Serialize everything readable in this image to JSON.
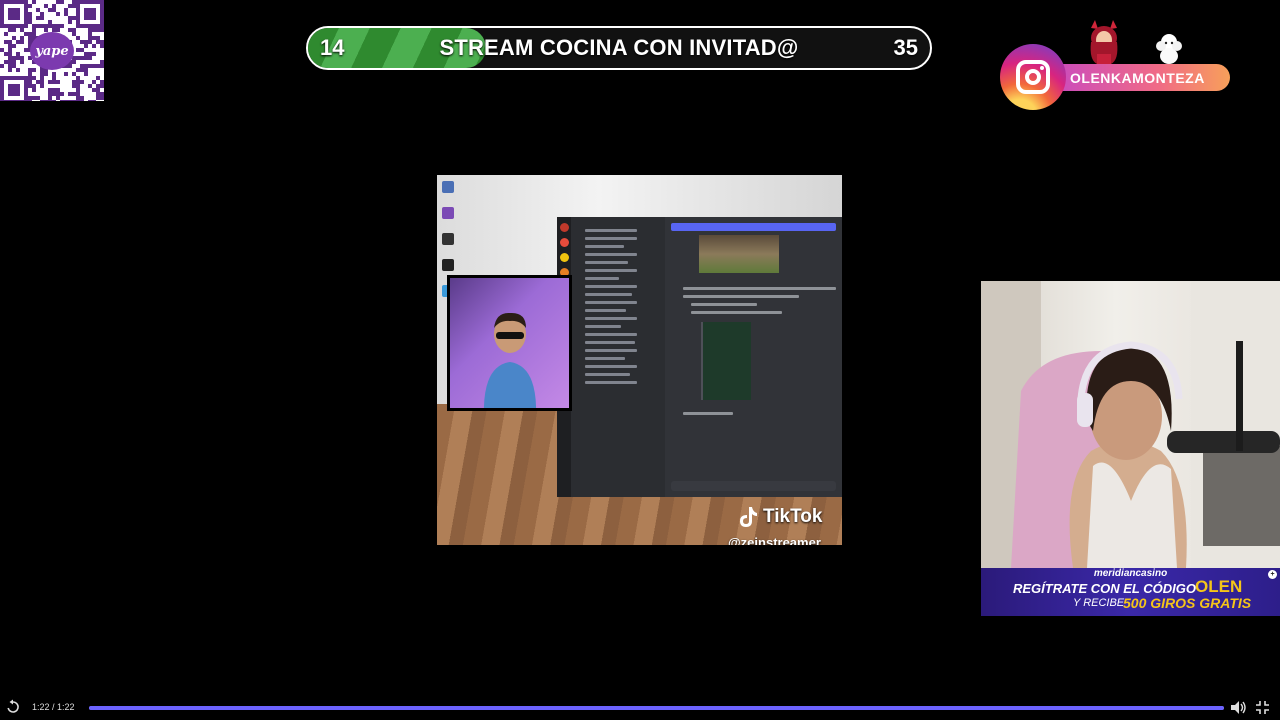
{
  "qr": {
    "brand": "yape"
  },
  "scorebar": {
    "left_score": "14",
    "title": "STREAM COCINA CON INVITAD@",
    "right_score": "35",
    "left_share": 0.286,
    "accent": "#4caf50"
  },
  "instagram": {
    "handle": "OLENKAMONTEZA",
    "icon": "instagram-icon"
  },
  "main_video": {
    "tiktok_label": "TikTok",
    "tiktok_handle": "@zeinstreamer"
  },
  "casino": {
    "brand": "meridiancasino",
    "line1": "REGÍTRATE CON EL CÓDIGO",
    "code": "OLEN",
    "line2": "Y RECIBE",
    "prize": "500 GIROS GRATIS",
    "badge": "+"
  },
  "player": {
    "time": "1:22 / 1:22",
    "progress": 1.0,
    "progress_color": "#6c63ff",
    "icons": [
      "replay-icon",
      "volume-icon",
      "exit-fullscreen-icon"
    ]
  }
}
